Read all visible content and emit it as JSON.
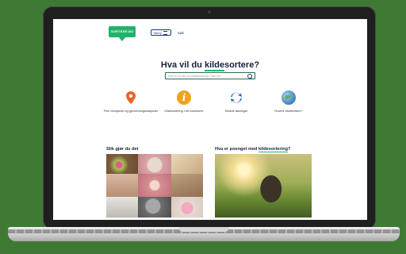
{
  "site": {
    "logo_text": "SORTERE.NO",
    "menu_label": "Meny",
    "nav_link": "Søk"
  },
  "hero": {
    "title_pre": "Hva vil du ",
    "title_hl": "kilde",
    "title_post": "sortere?",
    "search_placeholder": "Hva vil du vite om kildesortering? Søk her"
  },
  "quick_links": [
    {
      "label": "Finn returpunkt og gjenvinningsstasjoner",
      "icon": "location-pin-icon",
      "color": "#e8622a"
    },
    {
      "label": "Kildesortering i din kommune",
      "icon": "info-icon",
      "color": "#f0a21c"
    },
    {
      "label": "Smarte løsninger",
      "icon": "recycle-arrows-icon",
      "color": "#2b6fb3"
    },
    {
      "label": "Hvorfor kildesortere?",
      "icon": "globe-icon",
      "color": "#4a8fbf"
    }
  ],
  "sections": {
    "left_title": "Slik gjør du det",
    "right_title_pre": "Hva er poenget med ",
    "right_title_hl": "kildesortering",
    "right_title_post": "?"
  },
  "colors": {
    "brand_green": "#21b36b",
    "navy": "#1b3d7c",
    "background": "#3f7a35"
  }
}
